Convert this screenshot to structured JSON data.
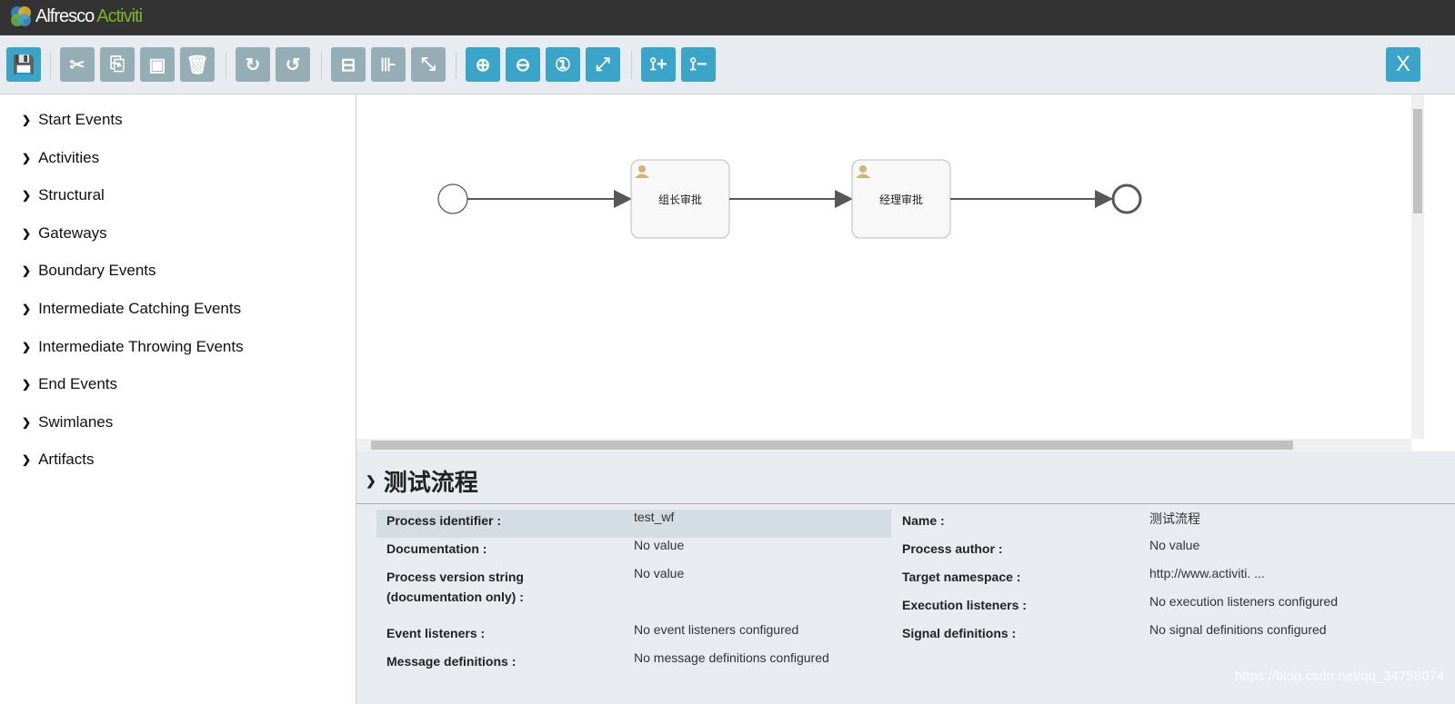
{
  "header": {
    "logo_primary": "Alfresco",
    "logo_secondary": "Activiti"
  },
  "toolbar": {
    "buttons": [
      {
        "name": "save",
        "icon": "save-icon",
        "glyph": "💾",
        "style": "teal"
      },
      {
        "name": "cut",
        "icon": "scissors-icon",
        "glyph": "✂",
        "style": "gray"
      },
      {
        "name": "copy",
        "icon": "copy-icon",
        "glyph": "⎘",
        "style": "gray"
      },
      {
        "name": "paste",
        "icon": "paste-icon",
        "glyph": "▣",
        "style": "gray"
      },
      {
        "name": "delete",
        "icon": "trash-icon",
        "glyph": "🗑",
        "style": "gray"
      },
      {
        "name": "redo",
        "icon": "redo-icon",
        "glyph": "↻",
        "style": "gray"
      },
      {
        "name": "undo",
        "icon": "undo-icon",
        "glyph": "↺",
        "style": "gray"
      },
      {
        "name": "align-horizontal",
        "icon": "align-horizontal-icon",
        "glyph": "⊟",
        "style": "gray"
      },
      {
        "name": "align-vertical",
        "icon": "align-vertical-icon",
        "glyph": "⊪",
        "style": "gray"
      },
      {
        "name": "same-size",
        "icon": "same-size-icon",
        "glyph": "⤡",
        "style": "gray"
      },
      {
        "name": "zoom-in",
        "icon": "zoom-in-icon",
        "glyph": "⊕",
        "style": "teal"
      },
      {
        "name": "zoom-out",
        "icon": "zoom-out-icon",
        "glyph": "⊖",
        "style": "teal"
      },
      {
        "name": "zoom-actual",
        "icon": "zoom-actual-icon",
        "glyph": "①",
        "style": "teal"
      },
      {
        "name": "zoom-fit",
        "icon": "zoom-fit-icon",
        "glyph": "⤢",
        "style": "teal"
      },
      {
        "name": "add-bendpoint",
        "icon": "add-bendpoint-icon",
        "glyph": "⟟+",
        "style": "teal"
      },
      {
        "name": "remove-bendpoint",
        "icon": "remove-bendpoint-icon",
        "glyph": "⟟−",
        "style": "teal"
      }
    ],
    "close_label": "X"
  },
  "palette": {
    "items": [
      "Start Events",
      "Activities",
      "Structural",
      "Gateways",
      "Boundary Events",
      "Intermediate Catching Events",
      "Intermediate Throwing Events",
      "End Events",
      "Swimlanes",
      "Artifacts"
    ]
  },
  "diagram": {
    "tasks": [
      "组长审批",
      "经理审批"
    ]
  },
  "properties": {
    "title": "测试流程",
    "left": [
      {
        "label": "Process identifier :",
        "value": "test_wf"
      },
      {
        "label": "Documentation :",
        "value": "No value"
      },
      {
        "label": "Process version string (documentation only) :",
        "value": "No value"
      },
      {
        "label": "Event listeners :",
        "value": "No event listeners configured"
      },
      {
        "label": "Message definitions :",
        "value": "No message definitions configured"
      }
    ],
    "right": [
      {
        "label": "Name :",
        "value": "测试流程"
      },
      {
        "label": "Process author :",
        "value": "No value"
      },
      {
        "label": "Target namespace :",
        "value": "http://www.activiti. ..."
      },
      {
        "label": "Execution listeners :",
        "value": "No execution listeners configured"
      },
      {
        "label": "Signal definitions :",
        "value": "No signal definitions configured"
      }
    ]
  },
  "watermark": "https://blog.csdn.net/qq_34758074",
  "colors": {
    "teal": "#3aa5c8",
    "gray": "#95adb4",
    "header": "#333333"
  }
}
